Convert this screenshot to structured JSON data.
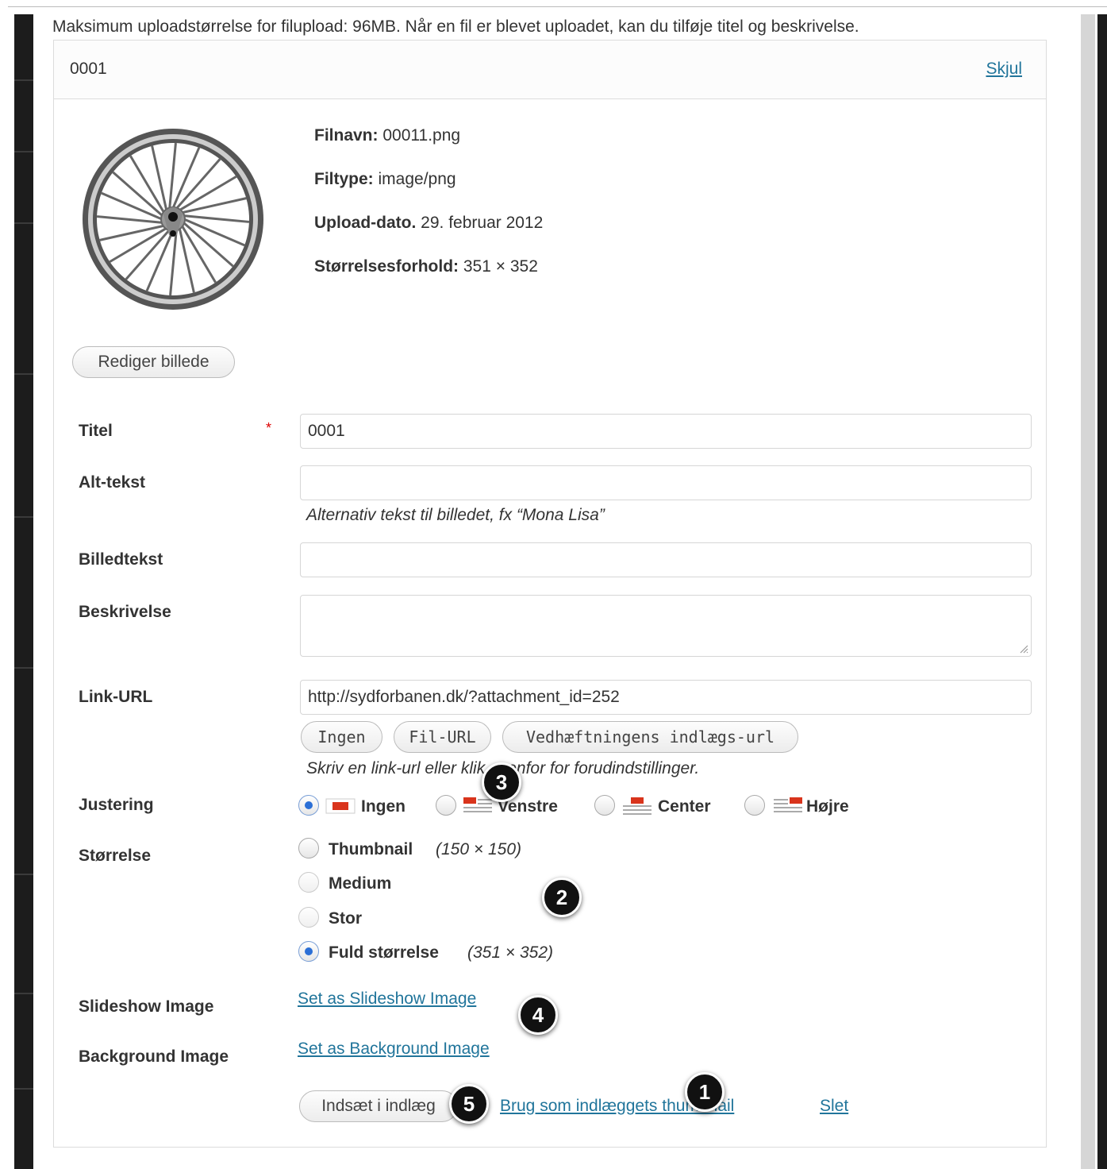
{
  "upload_info": "Maksimum uploadstørrelse for filupload: 96MB. Når en fil er blevet uploadet, kan du tilføje titel og beskrivelse.",
  "panel": {
    "title": "0001",
    "hide_label": "Skjul"
  },
  "thumbnail_icon": "bicycle-wheel-icon",
  "meta": {
    "filename_label": "Filnavn:",
    "filename": "00011.png",
    "filetype_label": "Filtype:",
    "filetype": "image/png",
    "date_label": "Upload-dato.",
    "date": "29. februar 2012",
    "size_label": "Størrelsesforhold:",
    "size": "351 × 352"
  },
  "edit_image_button": "Rediger billede",
  "form": {
    "title_label": "Titel",
    "title_required": "*",
    "title_value": "0001",
    "alt_label": "Alt-tekst",
    "alt_value": "",
    "alt_help": "Alternativ tekst til billedet, fx “Mona Lisa”",
    "caption_label": "Billedtekst",
    "caption_value": "",
    "description_label": "Beskrivelse",
    "description_value": "",
    "link_label": "Link-URL",
    "link_value": "http://sydforbanen.dk/?attachment_id=252",
    "link_buttons": [
      "Ingen",
      "Fil-URL",
      "Vedhæftningens indlægs-url"
    ],
    "link_help": "Skriv en link-url eller klik ovenfor for forudindstillinger.",
    "align_label": "Justering",
    "align_options": [
      {
        "label": "Ingen",
        "selected": true,
        "icon": "align-none-icon"
      },
      {
        "label": "Venstre",
        "selected": false,
        "icon": "align-left-icon"
      },
      {
        "label": "Center",
        "selected": false,
        "icon": "align-center-icon"
      },
      {
        "label": "Højre",
        "selected": false,
        "icon": "align-right-icon"
      }
    ],
    "size_label": "Størrelse",
    "size_options": [
      {
        "label": "Thumbnail",
        "dims": "(150 × 150)",
        "selected": false
      },
      {
        "label": "Medium",
        "dims": "",
        "selected": false
      },
      {
        "label": "Stor",
        "dims": "",
        "selected": false
      },
      {
        "label": "Fuld størrelse",
        "dims": "(351 × 352)",
        "selected": true
      }
    ],
    "slideshow_label": "Slideshow Image",
    "slideshow_link": "Set as Slideshow Image",
    "background_label": "Background Image",
    "background_link": "Set as Background Image"
  },
  "actions": {
    "insert_button": "Indsæt i indlæg",
    "featured_link": "Brug som indlæggets thumbnail",
    "delete_link": "Slet"
  },
  "callouts": [
    "1",
    "2",
    "3",
    "4",
    "5"
  ],
  "colors": {
    "link": "#21759b",
    "radio_selected": "#2b6fd6",
    "required": "#dd0000",
    "align_icon_red": "#d9341c"
  }
}
